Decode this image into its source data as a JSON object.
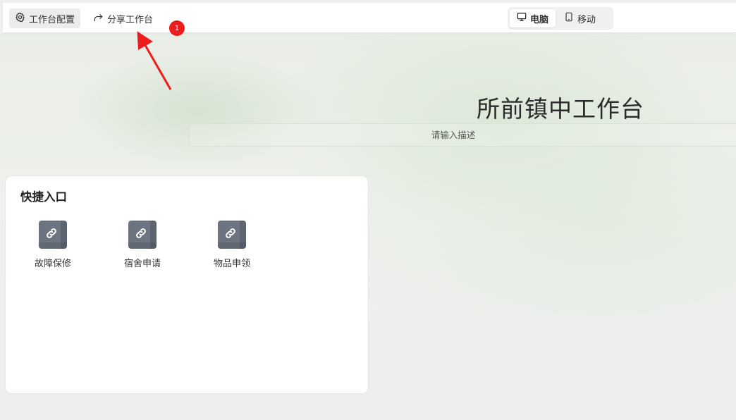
{
  "toolbar": {
    "config_label": "工作台配置",
    "config_icon": "gear-icon",
    "share_label": "分享工作台",
    "share_icon": "share-icon",
    "device_tabs": [
      {
        "label": "电脑",
        "icon": "monitor-icon",
        "active": true
      },
      {
        "label": "移动",
        "icon": "mobile-icon",
        "active": false
      }
    ]
  },
  "annotation": {
    "badge_number": "1",
    "color": "#ee1c1c"
  },
  "hero": {
    "title": "所前镇中工作台",
    "description_placeholder": "请输入描述"
  },
  "quick_access": {
    "title": "快捷入口",
    "items": [
      {
        "label": "故障保修",
        "icon": "link-icon"
      },
      {
        "label": "宿舍申请",
        "icon": "link-icon"
      },
      {
        "label": "物品申领",
        "icon": "link-icon"
      }
    ]
  },
  "colors": {
    "icon_tile": "#6b7480",
    "active_tab_bg": "#ececec"
  }
}
